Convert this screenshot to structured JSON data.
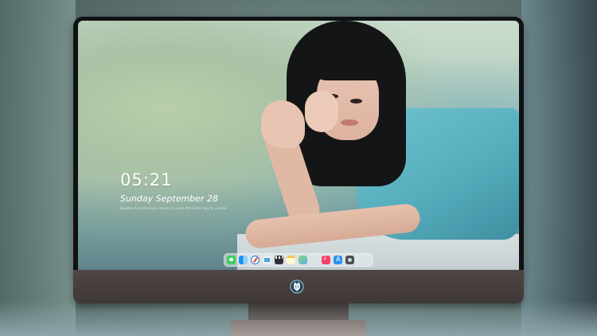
{
  "lockscreen": {
    "time": "05:21",
    "date": "Sunday September  28",
    "hint": "Double-click the lock screen or press the Enter key to unlock"
  },
  "dock": {
    "apps": [
      {
        "icon": "messages-icon"
      },
      {
        "icon": "finder-icon"
      },
      {
        "icon": "safari-icon"
      },
      {
        "icon": "preview-icon"
      },
      {
        "icon": "claquette-icon"
      },
      {
        "icon": "notes-icon"
      },
      {
        "icon": "maps-icon"
      },
      {
        "icon": "music-icon"
      },
      {
        "icon": "app-store-icon"
      },
      {
        "icon": "camera-icon"
      }
    ]
  },
  "device": {
    "bezel_color": "#101214",
    "chin_color": "#4e4645",
    "logo": "wolf-head-logo"
  }
}
